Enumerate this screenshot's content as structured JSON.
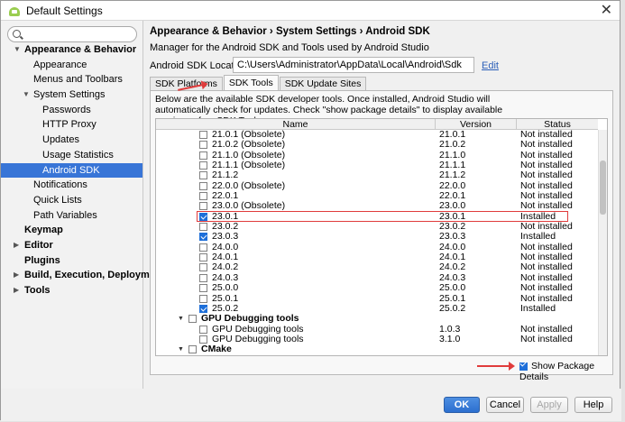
{
  "window": {
    "title": "Default Settings",
    "close_glyph": "✕"
  },
  "sidebar": {
    "search_placeholder": "",
    "items": [
      {
        "label": "Appearance & Behavior",
        "level": 0,
        "bold": true,
        "expanded": true
      },
      {
        "label": "Appearance",
        "level": 1
      },
      {
        "label": "Menus and Toolbars",
        "level": 1
      },
      {
        "label": "System Settings",
        "level": 1,
        "expanded": true
      },
      {
        "label": "Passwords",
        "level": 2
      },
      {
        "label": "HTTP Proxy",
        "level": 2
      },
      {
        "label": "Updates",
        "level": 2
      },
      {
        "label": "Usage Statistics",
        "level": 2
      },
      {
        "label": "Android SDK",
        "level": 2,
        "selected": true
      },
      {
        "label": "Notifications",
        "level": 1
      },
      {
        "label": "Quick Lists",
        "level": 1
      },
      {
        "label": "Path Variables",
        "level": 1
      },
      {
        "label": "Keymap",
        "level": 0,
        "bold": true
      },
      {
        "label": "Editor",
        "level": 0,
        "bold": true,
        "collapsed": true
      },
      {
        "label": "Plugins",
        "level": 0,
        "bold": true
      },
      {
        "label": "Build, Execution, Deployment",
        "level": 0,
        "bold": true,
        "collapsed": true
      },
      {
        "label": "Tools",
        "level": 0,
        "bold": true,
        "collapsed": true
      }
    ]
  },
  "content": {
    "breadcrumb": "Appearance & Behavior › System Settings › Android SDK",
    "description": "Manager for the Android SDK and Tools used by Android Studio",
    "location_label": "Android SDK Location:",
    "location_value": "C:\\Users\\Administrator\\AppData\\Local\\Android\\Sdk",
    "edit_label": "Edit",
    "tabs": [
      {
        "label": "SDK Platforms"
      },
      {
        "label": "SDK Tools",
        "active": true
      },
      {
        "label": "SDK Update Sites"
      }
    ],
    "panel_description": "Below are the available SDK developer tools. Once installed, Android Studio will automatically check for updates. Check \"show package details\" to display available versions of an SDK Tool.",
    "table": {
      "headers": [
        "Name",
        "Version",
        "Status"
      ],
      "rows": [
        {
          "name": "21.0.1 (Obsolete)",
          "version": "21.0.1",
          "status": "Not installed",
          "checked": false,
          "indent": 2
        },
        {
          "name": "21.0.2 (Obsolete)",
          "version": "21.0.2",
          "status": "Not installed",
          "checked": false,
          "indent": 2
        },
        {
          "name": "21.1.0 (Obsolete)",
          "version": "21.1.0",
          "status": "Not installed",
          "checked": false,
          "indent": 2
        },
        {
          "name": "21.1.1 (Obsolete)",
          "version": "21.1.1",
          "status": "Not installed",
          "checked": false,
          "indent": 2
        },
        {
          "name": "21.1.2",
          "version": "21.1.2",
          "status": "Not installed",
          "checked": false,
          "indent": 2
        },
        {
          "name": "22.0.0 (Obsolete)",
          "version": "22.0.0",
          "status": "Not installed",
          "checked": false,
          "indent": 2
        },
        {
          "name": "22.0.1",
          "version": "22.0.1",
          "status": "Not installed",
          "checked": false,
          "indent": 2
        },
        {
          "name": "23.0.0 (Obsolete)",
          "version": "23.0.0",
          "status": "Not installed",
          "checked": false,
          "indent": 2
        },
        {
          "name": "23.0.1",
          "version": "23.0.1",
          "status": "Installed",
          "checked": true,
          "indent": 2,
          "highlight": true
        },
        {
          "name": "23.0.2",
          "version": "23.0.2",
          "status": "Not installed",
          "checked": false,
          "indent": 2
        },
        {
          "name": "23.0.3",
          "version": "23.0.3",
          "status": "Installed",
          "checked": true,
          "indent": 2
        },
        {
          "name": "24.0.0",
          "version": "24.0.0",
          "status": "Not installed",
          "checked": false,
          "indent": 2
        },
        {
          "name": "24.0.1",
          "version": "24.0.1",
          "status": "Not installed",
          "checked": false,
          "indent": 2
        },
        {
          "name": "24.0.2",
          "version": "24.0.2",
          "status": "Not installed",
          "checked": false,
          "indent": 2
        },
        {
          "name": "24.0.3",
          "version": "24.0.3",
          "status": "Not installed",
          "checked": false,
          "indent": 2
        },
        {
          "name": "25.0.0",
          "version": "25.0.0",
          "status": "Not installed",
          "checked": false,
          "indent": 2
        },
        {
          "name": "25.0.1",
          "version": "25.0.1",
          "status": "Not installed",
          "checked": false,
          "indent": 2
        },
        {
          "name": "25.0.2",
          "version": "25.0.2",
          "status": "Installed",
          "checked": true,
          "indent": 2
        },
        {
          "name": "GPU Debugging tools",
          "version": "",
          "status": "",
          "checked": false,
          "indent": 1,
          "group": true
        },
        {
          "name": "GPU Debugging tools",
          "version": "1.0.3",
          "status": "Not installed",
          "checked": false,
          "indent": 2
        },
        {
          "name": "GPU Debugging tools",
          "version": "3.1.0",
          "status": "Not installed",
          "checked": false,
          "indent": 2
        },
        {
          "name": "CMake",
          "version": "",
          "status": "",
          "checked": false,
          "indent": 1,
          "group": true
        }
      ]
    },
    "show_details_label": "Show Package Details",
    "show_details_checked": true
  },
  "footer": {
    "ok_label": "OK",
    "cancel_label": "Cancel",
    "apply_label": "Apply",
    "help_label": "Help"
  },
  "colors": {
    "selection": "#3875d7",
    "highlight": "#e03c3c",
    "checkbox": "#1e6fd9",
    "link": "#2c5fb8"
  }
}
